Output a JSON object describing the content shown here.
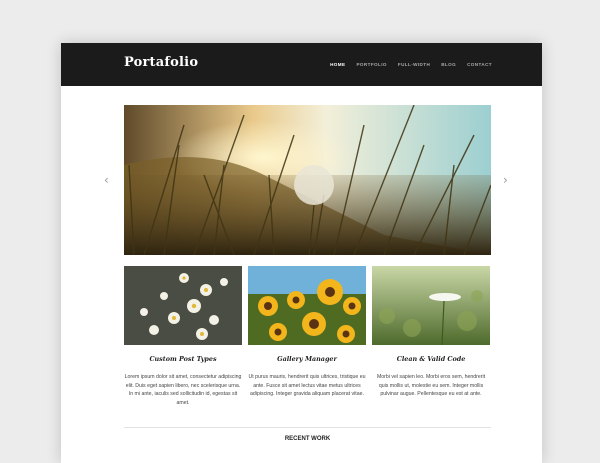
{
  "site": {
    "logo": "Portafolio"
  },
  "nav": {
    "items": [
      {
        "label": "HOME",
        "active": true
      },
      {
        "label": "PORTFOLIO",
        "active": false
      },
      {
        "label": "FULL-WIDTH",
        "active": false
      },
      {
        "label": "BLOG",
        "active": false
      },
      {
        "label": "CONTACT",
        "active": false
      }
    ]
  },
  "slider": {
    "prev_icon": "chevron-left-icon",
    "next_icon": "chevron-right-icon",
    "image": "dandelion-sunset-field"
  },
  "features": [
    {
      "title": "Custom Post Types",
      "text": "Lorem ipsum dolor sit amet, consectetur adipiscing elit. Duis eget sapien libero, nec scelerisque urna. In mi ante, iaculis sed sollicitudin id, egestas sit amet.",
      "image": "daisies"
    },
    {
      "title": "Gallery Manager",
      "text": "Ut purus mauris, hendrerit quis ultrices, tristique eu ante. Fusce sit amet lectus vitae metus ultrices adipiscing. Integer gravida aliquam placerat vitae.",
      "image": "sunflowers"
    },
    {
      "title": "Clean & Valid Code",
      "text": "Morbi vel sapien leo. Morbi eros sem, hendrerit quis mollis ut, molestie eu sem. Integer mollis pulvinar augue. Pellentesque eu est at ante.",
      "image": "white-wildflower"
    }
  ],
  "recent_work": {
    "heading": "RECENT WORK"
  },
  "colors": {
    "topbar": "#1b1b1b",
    "background": "#ececec",
    "nav_active": "#ffffff",
    "nav_inactive": "#a9a9a9"
  }
}
